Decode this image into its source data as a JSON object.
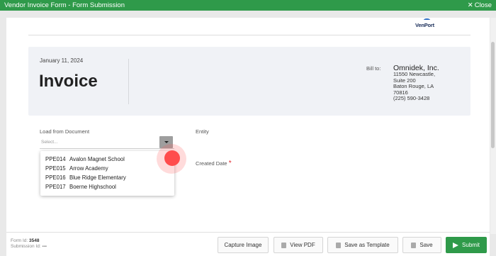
{
  "window": {
    "title": "Vendor Invoice Form - Form Submission",
    "close_label": "Close"
  },
  "brand": {
    "logo_text": "VenPort"
  },
  "invoice": {
    "date": "January 11, 2024",
    "title": "Invoice",
    "bill_to_label": "Bill to:",
    "company": "Omnidek, Inc.",
    "address": [
      "11550 Newcastle,",
      "Suite 200",
      "Baton Rouge, LA",
      "70816",
      "(225) 590-3428"
    ]
  },
  "form": {
    "load_label": "Load from Document",
    "load_placeholder": "Select...",
    "entity_label": "Entity",
    "created_date_label": "Created Date",
    "required_marker": "*",
    "dropdown_options": [
      {
        "code": "PPE014",
        "name": "Avalon Magnet School"
      },
      {
        "code": "PPE015",
        "name": "Arrow Academy"
      },
      {
        "code": "PPE016",
        "name": "Blue Ridge Elementary"
      },
      {
        "code": "PPE017",
        "name": "Boerne Highschool"
      }
    ]
  },
  "footer": {
    "form_id_label": "Form Id:",
    "form_id": "3548",
    "submission_id_label": "Submission Id:",
    "submission_id": "---",
    "buttons": {
      "capture": "Capture Image",
      "view_pdf": "View PDF",
      "save_template": "Save as Template",
      "save": "Save",
      "submit": "Submit"
    }
  },
  "colors": {
    "accent": "#2f9a4a",
    "required": "#e0262b",
    "cursor": "#ff4d4d"
  }
}
